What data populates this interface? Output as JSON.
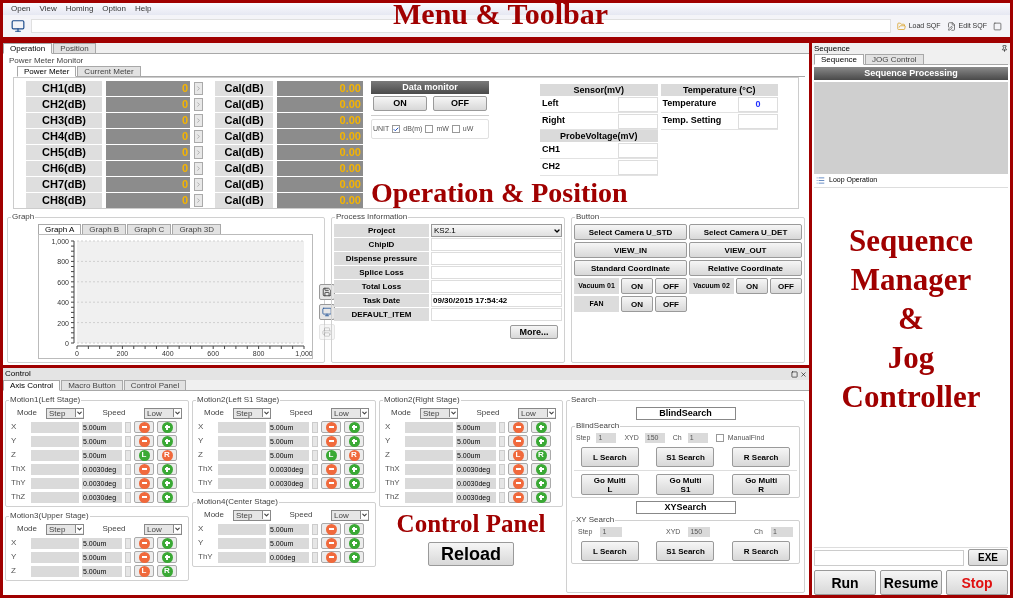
{
  "menu": [
    {
      "label": "Open"
    },
    {
      "label": "View"
    },
    {
      "label": "Homing"
    },
    {
      "label": "Option"
    },
    {
      "label": "Help"
    }
  ],
  "toolbar": {
    "buttons": [
      {
        "label": "Load SQF",
        "kind": "load"
      },
      {
        "label": "Edit SQF",
        "kind": "edit"
      }
    ]
  },
  "annotations": {
    "menu_toolbar": "Menu & Toolbar",
    "operation_position": "Operation & Position",
    "control_panel": "Control Panel",
    "sequence_jog": [
      "Sequence",
      "Manager",
      "&",
      "Jog",
      "Controller"
    ]
  },
  "operation": {
    "tabs": [
      {
        "label": "Operation",
        "selected": true
      },
      {
        "label": "Position",
        "selected": false
      }
    ],
    "power_meter": {
      "title": "Power Meter Monitor",
      "tabs": [
        {
          "label": "Power Meter",
          "selected": true
        },
        {
          "label": "Current Meter",
          "selected": false
        }
      ],
      "channels": [
        {
          "label": "CH1(dB)",
          "value": "0",
          "cal_label": "Cal(dB)",
          "cal_value": "0.00"
        },
        {
          "label": "CH2(dB)",
          "value": "0",
          "cal_label": "Cal(dB)",
          "cal_value": "0.00"
        },
        {
          "label": "CH3(dB)",
          "value": "0",
          "cal_label": "Cal(dB)",
          "cal_value": "0.00"
        },
        {
          "label": "CH4(dB)",
          "value": "0",
          "cal_label": "Cal(dB)",
          "cal_value": "0.00"
        },
        {
          "label": "CH5(dB)",
          "value": "0",
          "cal_label": "Cal(dB)",
          "cal_value": "0.00"
        },
        {
          "label": "CH6(dB)",
          "value": "0",
          "cal_label": "Cal(dB)",
          "cal_value": "0.00"
        },
        {
          "label": "CH7(dB)",
          "value": "0",
          "cal_label": "Cal(dB)",
          "cal_value": "0.00"
        },
        {
          "label": "CH8(dB)",
          "value": "0",
          "cal_label": "Cal(dB)",
          "cal_value": "0.00"
        }
      ]
    },
    "data_monitor": {
      "title": "Data monitor",
      "buttons": [
        "ON",
        "OFF"
      ]
    },
    "unit": {
      "label": "UNIT",
      "options": [
        {
          "label": "dB(m)",
          "checked": true
        },
        {
          "label": "mW",
          "checked": false
        },
        {
          "label": "uW",
          "checked": false
        }
      ]
    },
    "sensor": {
      "title": "Sensor(mV)",
      "rows": [
        {
          "label": "Left"
        },
        {
          "label": "Right"
        }
      ]
    },
    "probe": {
      "title": "ProbeVoltage(mV)",
      "rows": [
        {
          "label": "CH1"
        },
        {
          "label": "CH2"
        }
      ]
    },
    "temperature": {
      "title": "Temperature (°C)",
      "rows": [
        {
          "label": "Temperature",
          "value": "0"
        },
        {
          "label": "Temp. Setting"
        }
      ]
    },
    "graph": {
      "title": "Graph",
      "tabs": [
        {
          "label": "Graph A",
          "selected": true
        },
        {
          "label": "Graph B",
          "selected": false
        },
        {
          "label": "Graph C",
          "selected": false
        },
        {
          "label": "Graph 3D",
          "selected": false
        }
      ],
      "chart_data": {
        "type": "line",
        "grid": true,
        "xlim": [
          0,
          1000
        ],
        "ylim": [
          0,
          1000
        ],
        "xticks": [
          {
            "value": 0,
            "label": "0"
          },
          {
            "value": 200,
            "label": "200"
          },
          {
            "value": 400,
            "label": "400"
          },
          {
            "value": 600,
            "label": "600"
          },
          {
            "value": 800,
            "label": "800"
          },
          {
            "value": 1000,
            "label": "1,000"
          }
        ],
        "yticks": [
          {
            "value": 0,
            "label": "0"
          },
          {
            "value": 200,
            "label": "200"
          },
          {
            "value": 400,
            "label": "400"
          },
          {
            "value": 600,
            "label": "600"
          },
          {
            "value": 800,
            "label": "800"
          },
          {
            "value": 1000,
            "label": "1,000"
          }
        ]
      },
      "tools": [
        {
          "kind": "save",
          "disabled": false
        },
        {
          "kind": "monitor",
          "disabled": false
        },
        {
          "kind": "print",
          "disabled": true
        }
      ]
    },
    "process": {
      "title": "Process Information",
      "rows": [
        {
          "label": "Project",
          "value": "KS2.1",
          "kind": "dropdown"
        },
        {
          "label": "ChipID",
          "kind": "field"
        },
        {
          "label": "Dispense pressure",
          "kind": "field"
        },
        {
          "label": "Splice Loss",
          "kind": "field"
        },
        {
          "label": "Total Loss",
          "kind": "field"
        },
        {
          "label": "Task Date",
          "value": "09/30/2015 17:54:42",
          "kind": "field"
        },
        {
          "label": "DEFAULT_ITEM",
          "kind": "field"
        }
      ],
      "more": "More..."
    },
    "buttons": {
      "title": "Button",
      "actions": [
        "Select Camera U_STD",
        "Select Camera U_DET",
        "VIEW_IN",
        "VIEW_OUT",
        "Standard Coordinate",
        "Relative Coordinate"
      ],
      "toggles": [
        {
          "label": "Vacuum 01",
          "on": "ON",
          "off": "OFF"
        },
        {
          "label": "Vacuum 02",
          "on": "ON",
          "off": "OFF"
        },
        {
          "label": "FAN",
          "on": "ON",
          "off": "OFF"
        }
      ]
    }
  },
  "control": {
    "title": "Control",
    "tabs": [
      {
        "label": "Axis Control",
        "selected": true
      },
      {
        "label": "Macro Button",
        "selected": false
      },
      {
        "label": "Control Panel",
        "selected": false
      }
    ],
    "motions": [
      {
        "title": "Motion1(Left Stage)",
        "mode_label": "Mode",
        "mode": "Step",
        "speed_label": "Speed",
        "speed": "Low",
        "axes": [
          {
            "label": "X",
            "step": "5.00um",
            "kind": "jog"
          },
          {
            "label": "Y",
            "step": "5.00um",
            "kind": "jog"
          },
          {
            "label": "Z",
            "step": "5.00um",
            "kind": "lr",
            "buttons": [
              {
                "text": "L",
                "color": "#3aa935"
              },
              {
                "text": "R",
                "color": "#f0693c"
              }
            ]
          },
          {
            "label": "ThX",
            "step": "0.0030deg",
            "kind": "jog"
          },
          {
            "label": "ThY",
            "step": "0.0030deg",
            "kind": "jog"
          },
          {
            "label": "ThZ",
            "step": "0.0030deg",
            "kind": "jog"
          }
        ]
      },
      {
        "title": "Motion3(Upper Stage)",
        "mode_label": "Mode",
        "mode": "Step",
        "speed_label": "Speed",
        "speed": "Low",
        "axes": [
          {
            "label": "X",
            "step": "5.00um",
            "kind": "jog"
          },
          {
            "label": "Y",
            "step": "5.00um",
            "kind": "jog"
          },
          {
            "label": "Z",
            "step": "5.00um",
            "kind": "lr",
            "buttons": [
              {
                "text": "L",
                "color": "#f0693c"
              },
              {
                "text": "R",
                "color": "#3aa935"
              }
            ]
          }
        ]
      },
      {
        "title": "Motion2(Left S1 Stage)",
        "mode_label": "Mode",
        "mode": "Step",
        "speed_label": "Speed",
        "speed": "Low",
        "axes": [
          {
            "label": "X",
            "step": "5.00um",
            "kind": "jog"
          },
          {
            "label": "Y",
            "step": "5.00um",
            "kind": "jog"
          },
          {
            "label": "Z",
            "step": "5.00um",
            "kind": "lr",
            "buttons": [
              {
                "text": "L",
                "color": "#3aa935"
              },
              {
                "text": "R",
                "color": "#f0693c"
              }
            ]
          },
          {
            "label": "ThX",
            "step": "0.0030deg",
            "kind": "jog"
          },
          {
            "label": "ThY",
            "step": "0.0030deg",
            "kind": "jog"
          }
        ]
      },
      {
        "title": "Motion4(Center Stage)",
        "mode_label": "Mode",
        "mode": "Step",
        "speed_label": "Speed",
        "speed": "Low",
        "axes": [
          {
            "label": "X",
            "step": "5.00um",
            "kind": "jog"
          },
          {
            "label": "Y",
            "step": "5.00um",
            "kind": "jog"
          },
          {
            "label": "ThY",
            "step": "0.00deg",
            "kind": "jog"
          }
        ]
      },
      {
        "title": "Motion2(Right Stage)",
        "mode_label": "Mode",
        "mode": "Step",
        "speed_label": "Speed",
        "speed": "Low",
        "axes": [
          {
            "label": "X",
            "step": "5.00um",
            "kind": "jog"
          },
          {
            "label": "Y",
            "step": "5.00um",
            "kind": "jog"
          },
          {
            "label": "Z",
            "step": "5.00um",
            "kind": "lr",
            "buttons": [
              {
                "text": "L",
                "color": "#f0693c"
              },
              {
                "text": "R",
                "color": "#3aa935"
              }
            ]
          },
          {
            "label": "ThX",
            "step": "0.0030deg",
            "kind": "jog"
          },
          {
            "label": "ThY",
            "step": "0.0030deg",
            "kind": "jog"
          },
          {
            "label": "ThZ",
            "step": "0.0030deg",
            "kind": "jog"
          }
        ]
      }
    ],
    "reload": "Reload",
    "search": {
      "title": "Search",
      "blind": {
        "header": "BlindSearch",
        "group": "BlindSearch",
        "fields": [
          {
            "label": "Step",
            "value": "1"
          },
          {
            "label": "XYD",
            "value": "150"
          },
          {
            "label": "Ch",
            "value": "1"
          }
        ],
        "manual": {
          "label": "ManualFind",
          "checked": false
        },
        "buttons": [
          "L Search",
          "S1 Search",
          "R Search"
        ],
        "multi": [
          "Go Multi\nL",
          "Go Multi\nS1",
          "Go Multi\nR"
        ]
      },
      "xy": {
        "header": "XYSearch",
        "group": "XY Search",
        "fields": [
          {
            "label": "Step",
            "value": "1"
          },
          {
            "label": "XYD",
            "value": "150"
          },
          {
            "label": "Ch",
            "value": "1"
          }
        ],
        "buttons": [
          "L Search",
          "S1 Search",
          "R Search"
        ]
      }
    }
  },
  "sequence": {
    "title": "Sequence",
    "tabs": [
      {
        "label": "Sequence",
        "selected": true
      },
      {
        "label": "JOG Control",
        "selected": false
      }
    ],
    "header": "Sequence Processing",
    "loop": "Loop Operation",
    "exe": "EXE",
    "actions": [
      {
        "label": "Run",
        "kind": "normal"
      },
      {
        "label": "Resume",
        "kind": "normal"
      },
      {
        "label": "Stop",
        "kind": "danger"
      }
    ]
  }
}
